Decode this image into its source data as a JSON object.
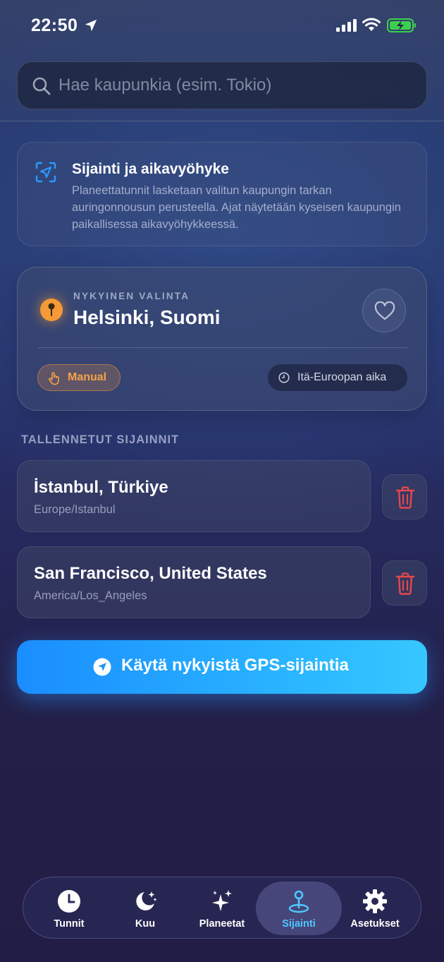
{
  "status_bar": {
    "time": "22:50"
  },
  "search": {
    "placeholder": "Hae kaupunkia (esim. Tokio)",
    "value": ""
  },
  "info_card": {
    "title": "Sijainti ja aikavyöhyke",
    "body": "Planeettatunnit lasketaan valitun kaupungin tarkan auringonnousun perusteella. Ajat näytetään kyseisen kaupungin paikallisessa aikavyöhykkeessä."
  },
  "current": {
    "label": "NYKYINEN VALINTA",
    "city": "Helsinki, Suomi",
    "mode_label": "Manual",
    "timezone_label": "Itä-Euroopan aika"
  },
  "saved": {
    "title": "TALLENNETUT SIJAINNIT",
    "items": [
      {
        "name": "İstanbul, Türkiye",
        "timezone": "Europe/Istanbul"
      },
      {
        "name": "San Francisco, United States",
        "timezone": "America/Los_Angeles"
      }
    ]
  },
  "gps_button": {
    "label": "Käytä nykyistä GPS-sijaintia"
  },
  "tabs": [
    {
      "label": "Tunnit",
      "icon": "clock-icon"
    },
    {
      "label": "Kuu",
      "icon": "moon-icon"
    },
    {
      "label": "Planeetat",
      "icon": "sparkles-icon"
    },
    {
      "label": "Sijainti",
      "icon": "location-pin-icon",
      "active": true
    },
    {
      "label": "Asetukset",
      "icon": "gear-icon"
    }
  ],
  "colors": {
    "accent_blue": "#2bb7ff",
    "active_tab": "#4cc8ff",
    "pin_orange": "#f49a36",
    "delete_red": "#e5484d",
    "battery_green": "#3ccf4e"
  }
}
